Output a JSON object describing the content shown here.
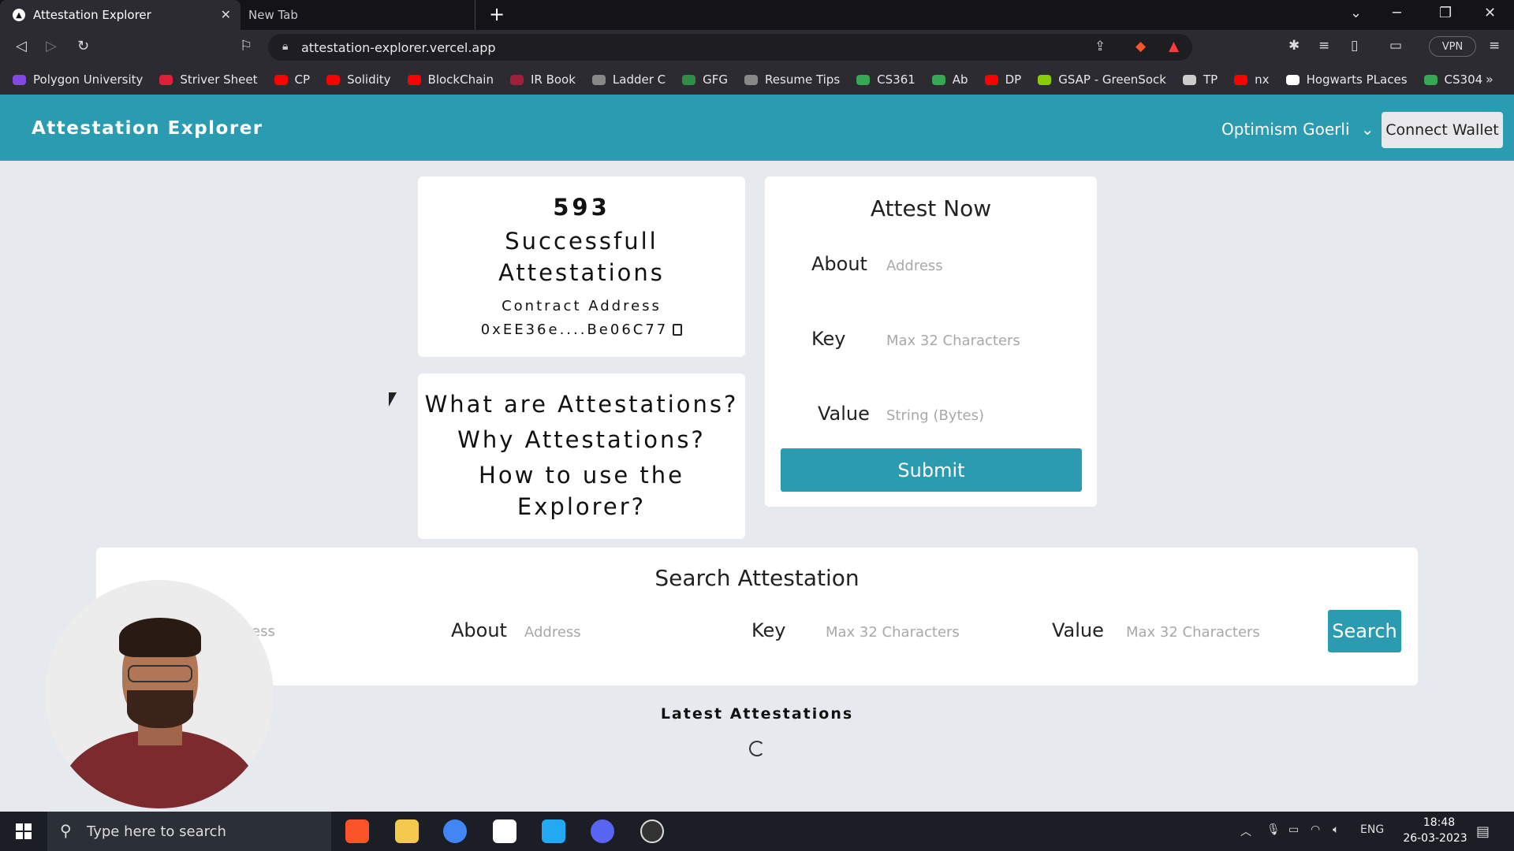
{
  "browser": {
    "tabs": [
      {
        "title": "Attestation Explorer",
        "active": true
      },
      {
        "title": "New Tab",
        "active": false
      }
    ],
    "new_tab": "+",
    "url": "attestation-explorer.vercel.app",
    "vpn_label": "VPN",
    "bookmarks": [
      {
        "label": "Polygon University",
        "color": "#8247e5"
      },
      {
        "label": "Striver Sheet",
        "color": "#e0203a"
      },
      {
        "label": "CP",
        "color": "#ff0000"
      },
      {
        "label": "Solidity",
        "color": "#ff0000"
      },
      {
        "label": "BlockChain",
        "color": "#ff0000"
      },
      {
        "label": "IR Book",
        "color": "#a0203a"
      },
      {
        "label": "Ladder C",
        "color": "#888888"
      },
      {
        "label": "GFG",
        "color": "#2f8d46"
      },
      {
        "label": "Resume Tips",
        "color": "#888888"
      },
      {
        "label": "CS361",
        "color": "#34a853"
      },
      {
        "label": "Ab",
        "color": "#34a853"
      },
      {
        "label": "DP",
        "color": "#ff0000"
      },
      {
        "label": "GSAP - GreenSock",
        "color": "#88ce02"
      },
      {
        "label": "TP",
        "color": "#cccccc"
      },
      {
        "label": "nx",
        "color": "#ff0000"
      },
      {
        "label": "Hogwarts PLaces",
        "color": "#ffffff"
      },
      {
        "label": "CS304",
        "color": "#34a853"
      }
    ],
    "more_bookmarks": "»"
  },
  "app": {
    "brand": "Attestation Explorer",
    "network": "Optimism Goerli",
    "connect_label": "Connect Wallet",
    "accent_color": "#2a9bb0"
  },
  "stats": {
    "count": "593",
    "label": "Successfull Attestations",
    "contract_label": "Contract Address",
    "contract_address": "0xEE36e....Be06C77"
  },
  "faq": {
    "line1": "What are Attestations?",
    "line2": "Why Attestations?",
    "line3": "How to use the",
    "line4": "Explorer?"
  },
  "attest": {
    "title": "Attest Now",
    "about_label": "About",
    "about_placeholder": "Address",
    "key_label": "Key",
    "key_placeholder": "Max 32 Characters",
    "value_label": "Value",
    "value_placeholder": "String (Bytes)",
    "submit_label": "Submit"
  },
  "search": {
    "title": "Search Attestation",
    "partial_placeholder": "ress",
    "about_label": "About",
    "about_placeholder": "Address",
    "key_label": "Key",
    "key_placeholder": "Max 32 Characters",
    "value_label": "Value",
    "value_placeholder": "Max 32 Characters",
    "search_label": "Search"
  },
  "latest": {
    "title": "Latest Attestations"
  },
  "taskbar": {
    "search_placeholder": "Type here to search",
    "language": "ENG",
    "time": "18:48",
    "date": "26-03-2023"
  }
}
